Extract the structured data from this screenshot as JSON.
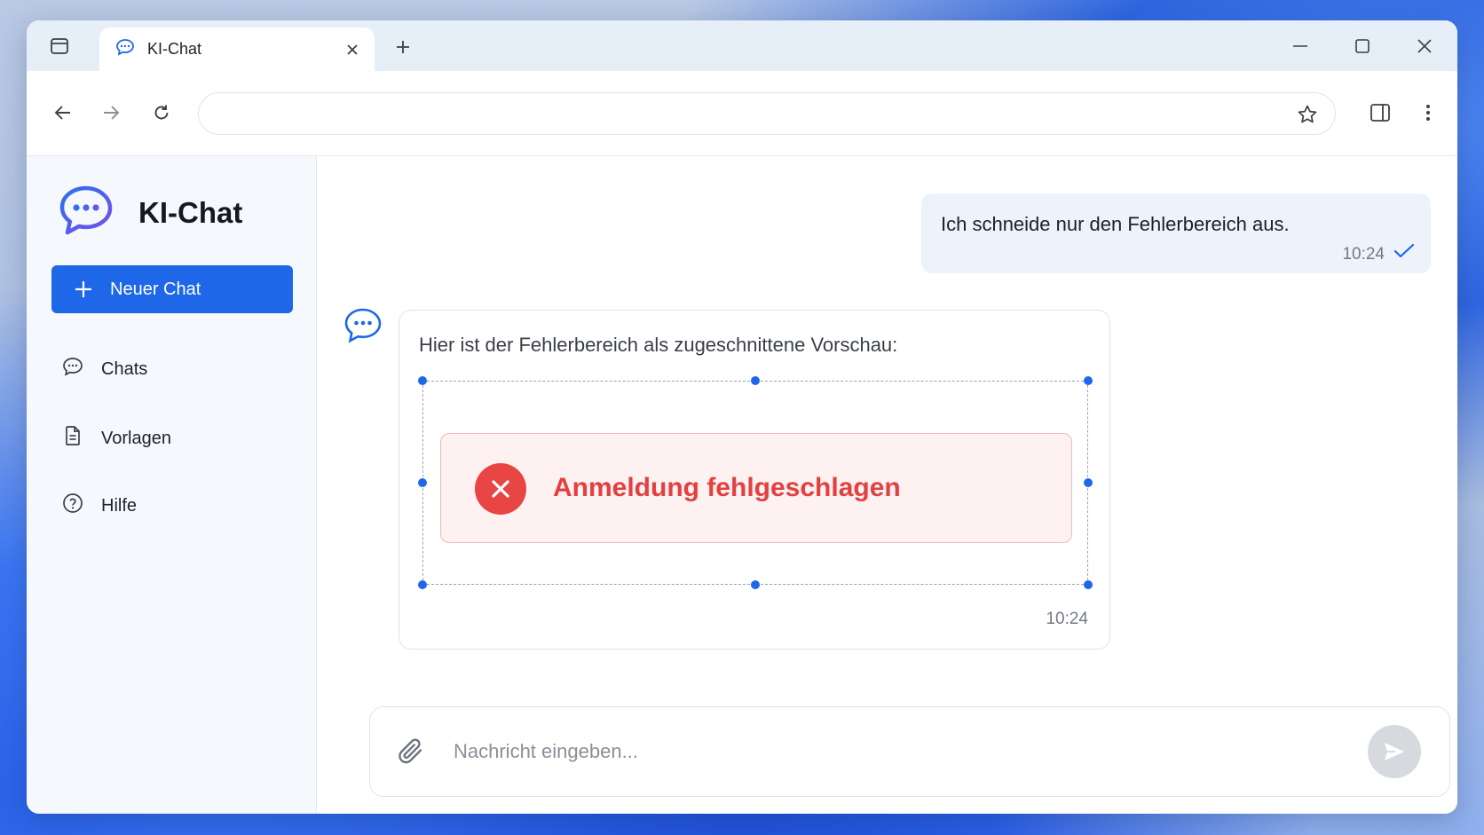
{
  "browser": {
    "tab_title": "KI-Chat",
    "address_value": ""
  },
  "sidebar": {
    "brand": "KI-Chat",
    "new_chat_label": "Neuer Chat",
    "items": [
      {
        "label": "Chats",
        "icon": "chat-bubble-icon"
      },
      {
        "label": "Vorlagen",
        "icon": "document-icon"
      },
      {
        "label": "Hilfe",
        "icon": "help-icon"
      }
    ]
  },
  "conversation": {
    "user_message": {
      "text": "Ich schneide nur den Fehlerbereich aus.",
      "time": "10:24",
      "status": "read-check"
    },
    "bot_message": {
      "text": "Hier ist der Fehlerbereich als zugeschnittene Vorschau:",
      "error_preview": "Anmeldung fehlgeschlagen",
      "time": "10:24"
    }
  },
  "composer": {
    "placeholder": "Nachricht eingeben...",
    "value": ""
  },
  "colors": {
    "accent": "#1f67e9",
    "error": "#e34040",
    "error_bg": "#fdf1f1"
  }
}
